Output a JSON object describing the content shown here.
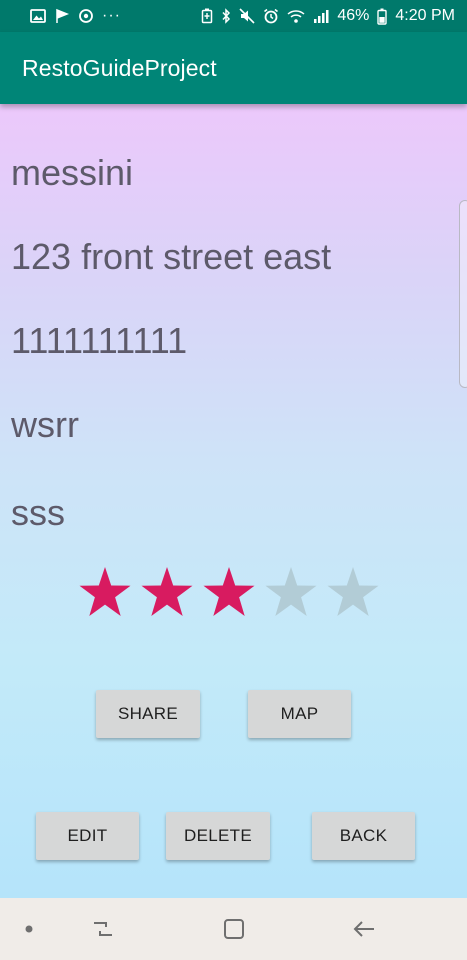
{
  "status_bar": {
    "left_icons": [
      "image-icon",
      "flag-icon",
      "sync-icon",
      "more-dots-icon"
    ],
    "right_icons": [
      "battery-saver-icon",
      "bluetooth-icon",
      "mute-icon",
      "alarm-icon",
      "wifi-icon",
      "signal-icon"
    ],
    "battery": "46%",
    "time": "4:20 PM",
    "more_dots": "···"
  },
  "app_bar": {
    "title": "RestoGuideProject"
  },
  "restaurant": {
    "name": "messini",
    "address": "123 front street east",
    "phone": "1111111111",
    "tags": "wsrr",
    "description": "sss"
  },
  "rating": {
    "value": 3,
    "max": 5,
    "filled_color": "#d81b60",
    "empty_color": "#b2ccd6"
  },
  "buttons": {
    "share": "SHARE",
    "map": "MAP",
    "edit": "EDIT",
    "delete": "DELETE",
    "back": "BACK"
  },
  "nav_bar": {
    "icons": [
      "dot-icon",
      "recent-apps-icon",
      "home-icon",
      "back-arrow-icon"
    ]
  }
}
